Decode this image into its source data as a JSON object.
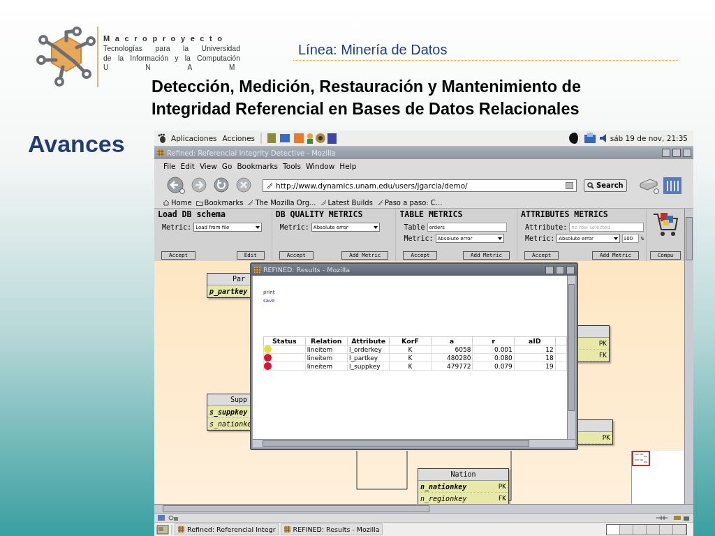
{
  "slide": {
    "org": [
      "Macroproyecto",
      "Tecnologías para la Universidad",
      "de la Información y la Computación",
      "UNAM"
    ],
    "line": "Línea: Minería de Datos",
    "title": "Detección, Medición, Restauración y Mantenimiento de Integridad Referencial en Bases de Datos Relacionales",
    "heading": "Avances"
  },
  "panel": {
    "menus": [
      "Aplicaciones",
      "Acciones"
    ],
    "clock": "sáb 19 de nov, 21:35"
  },
  "browser": {
    "title": "Refined: Referencial Integrity Detective - Mozilla",
    "menu": [
      "File",
      "Edit",
      "View",
      "Go",
      "Bookmarks",
      "Tools",
      "Window",
      "Help"
    ],
    "url": "http://www.dynamics.unam.edu/users/jgarcia/demo/",
    "search": "Search",
    "bookmarks": [
      "Home",
      "Bookmarks",
      "The Mozilla Org...",
      "Latest Builds",
      "Paso a paso: C..."
    ]
  },
  "sections": [
    {
      "title": "Load DB schema",
      "fields": [
        {
          "label": "Metric:",
          "kind": "select",
          "value": "Load from file"
        }
      ],
      "buttons": [
        "Accept",
        "Edit"
      ]
    },
    {
      "title": "DB QUALITY METRICS",
      "fields": [
        {
          "label": "Metric:",
          "kind": "select",
          "value": "Absolute error"
        }
      ],
      "buttons": [
        "Accept",
        "Add Metric"
      ]
    },
    {
      "title": "TABLE METRICS",
      "fields": [
        {
          "label": "Table",
          "kind": "text",
          "value": "orders"
        },
        {
          "label": "Metric:",
          "kind": "select",
          "value": "Absolute error"
        }
      ],
      "buttons": [
        "Accept",
        "Add Metric"
      ]
    },
    {
      "title": "ATTRIBUTES METRICS",
      "fields": [
        {
          "label": "Attribute:",
          "kind": "text",
          "placeholder": "no row selected"
        },
        {
          "label": "Metric:",
          "kind": "select",
          "value": "Absolute error",
          "extra": "100",
          "unit": "%"
        }
      ],
      "buttons": [
        "Accept",
        "Add Metric"
      ]
    },
    {
      "buttons": [
        "Compu"
      ]
    }
  ],
  "entities": [
    {
      "title": "Par",
      "fields": [
        {
          "name": "p_partkey",
          "primary": true
        }
      ]
    },
    {
      "title": "Supp",
      "fields": [
        {
          "name": "s_suppkey",
          "primary": true
        },
        {
          "name": "s_nationke",
          "primary": false
        }
      ]
    },
    {
      "fields": [
        {
          "key": "PK"
        },
        {
          "key": "FK"
        }
      ]
    },
    {
      "fields": [
        {
          "key": "PK"
        }
      ]
    },
    {
      "title": "Nation",
      "fields": [
        {
          "name": "n_nationkey",
          "key": "PK",
          "primary": true
        },
        {
          "name": "n_regionkey",
          "key": "FK",
          "primary": false
        }
      ]
    }
  ],
  "results": {
    "title": "REFINED: Results - Mozilla",
    "links": [
      "print",
      "save"
    ],
    "columns": [
      "Status",
      "Relation",
      "Attribute",
      "KorF",
      "a",
      "r",
      "aID"
    ],
    "rows": [
      {
        "color": "#e2de48",
        "cells": [
          "",
          "lineitem",
          "l_orderkey",
          "K",
          "6058",
          "0.001",
          "12"
        ]
      },
      {
        "color": "#d4163a",
        "cells": [
          "",
          "lineitem",
          "l_partkey",
          "K",
          "480280",
          "0.080",
          "18"
        ]
      },
      {
        "color": "#d4163a",
        "cells": [
          "",
          "lineitem",
          "l_suppkey",
          "K",
          "479772",
          "0.079",
          "19"
        ]
      }
    ]
  },
  "taskbar": [
    "Refined: Referencial Integr",
    "REFINED: Results - Mozilla"
  ]
}
